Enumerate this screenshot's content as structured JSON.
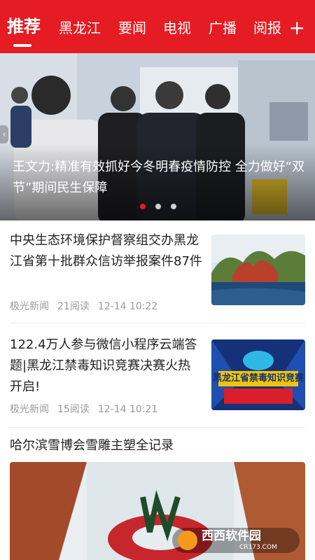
{
  "tabs": [
    {
      "label": "推荐",
      "active": true
    },
    {
      "label": "黑龙江"
    },
    {
      "label": "要闻"
    },
    {
      "label": "电视"
    },
    {
      "label": "广播"
    },
    {
      "label": "阅报"
    }
  ],
  "add_icon": "+",
  "banner": {
    "headline": "王文力:精准有效抓好今冬明春疫情防控 全力做好“双节”期间民生保障",
    "dots": 3,
    "active_dot": 0
  },
  "news": [
    {
      "title": "中央生态环境保护督察组交办黑龙江省第十批群众信访举报案件87件",
      "source": "极光新闻",
      "reads": "21阅读",
      "time": "12-14 10:22"
    },
    {
      "title": "122.4万人参与微信小程序云端答题|黑龙江禁毒知识竞赛决赛火热开启!",
      "source": "极光新闻",
      "reads": "15阅读",
      "time": "12-14 10:21",
      "thumb_text": "黑龙江省禁毒知识竞赛"
    },
    {
      "title": "哈尔滨雪博会雪雕主塑全记录"
    }
  ],
  "watermark": {
    "text": "西西软件园",
    "sub": "CR173.COM"
  },
  "colors": {
    "brand": "#e51c23",
    "meta": "#999999"
  }
}
